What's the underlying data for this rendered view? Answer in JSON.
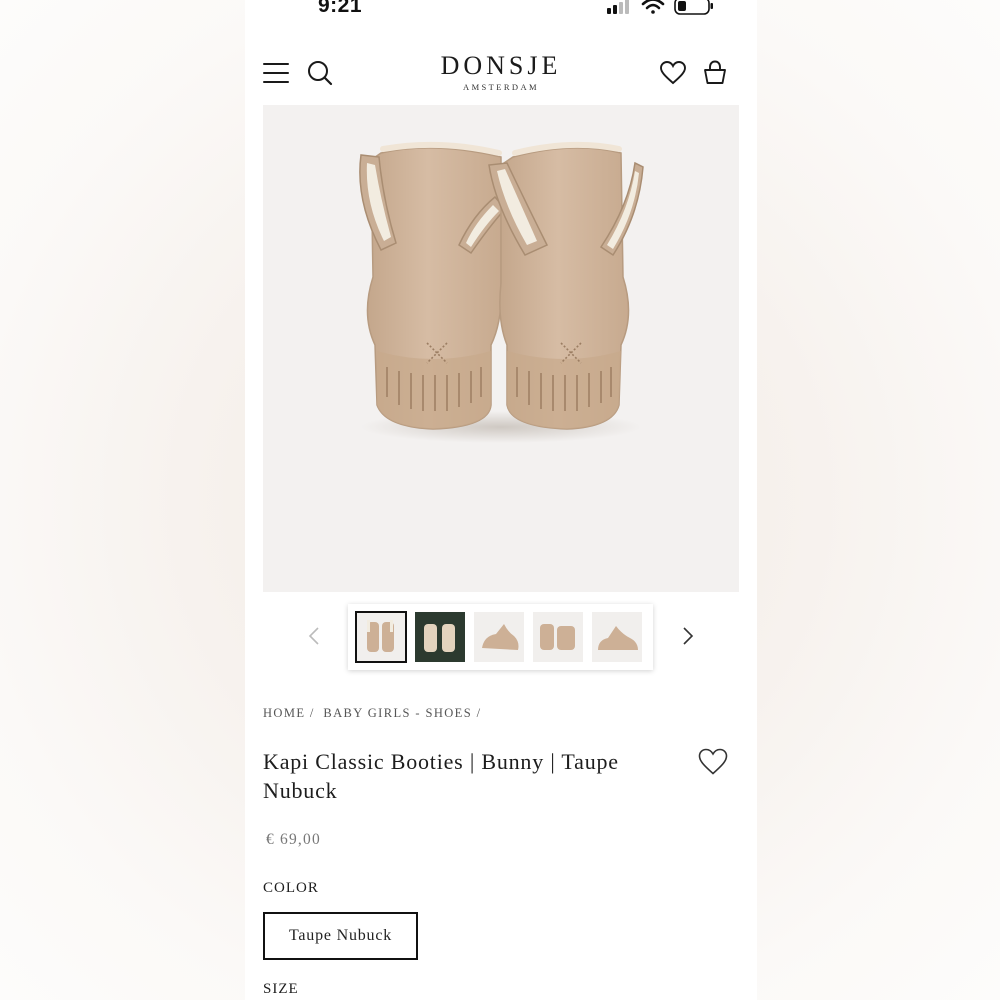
{
  "status_bar": {
    "time": "9:21"
  },
  "header": {
    "brand": "DONSJE",
    "brand_sub": "AMSTERDAM",
    "icons": [
      "menu-icon",
      "search-icon",
      "heart-icon",
      "basket-icon"
    ]
  },
  "gallery": {
    "thumbnails": [
      {
        "name": "thumbnail-front",
        "active": true
      },
      {
        "name": "thumbnail-lifestyle",
        "active": false
      },
      {
        "name": "thumbnail-side",
        "active": false
      },
      {
        "name": "thumbnail-back",
        "active": false
      },
      {
        "name": "thumbnail-profile",
        "active": false
      }
    ],
    "prev_icon": "chevron-left-icon",
    "next_icon": "chevron-right-icon"
  },
  "breadcrumb": [
    "HOME /",
    "BABY GIRLS - SHOES /"
  ],
  "product": {
    "title": "Kapi Classic Booties | Bunny | Taupe Nubuck",
    "price": "€ 69,00",
    "color_label": "COLOR",
    "color_value": "Taupe Nubuck",
    "size_label": "SIZE"
  },
  "colors": {
    "accent": "#111111",
    "boot": "#d0b59c",
    "price": "#777777"
  }
}
